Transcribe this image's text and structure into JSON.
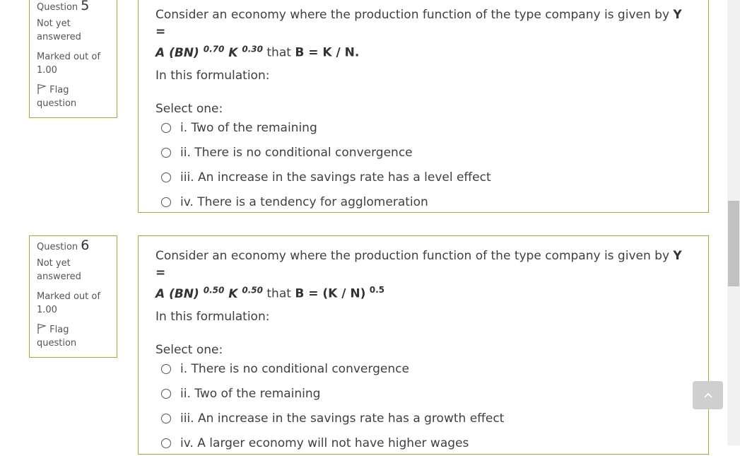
{
  "questions": [
    {
      "label": "Question",
      "number": "5",
      "state_line1": "Not yet",
      "state_line2": "answered",
      "grade_line1": "Marked out of",
      "grade_line2": "1.00",
      "flag_line1": "Flag",
      "flag_line2": "question",
      "text_line1": "Consider an economy where the production function of the type company is given by ",
      "text_y": "Y =",
      "text_a": "A (BN)",
      "exp1": "0.70",
      "text_k": "K",
      "exp2": "0.30",
      "text_that": " that ",
      "text_b": "B = K / N.",
      "exp3": "",
      "sub": "In this formulation:",
      "prompt": "Select one:",
      "options": [
        "i. Two of the remaining",
        "ii. There is no conditional convergence",
        "iii. An increase in the savings rate has a level effect",
        "iv. There is a tendency for agglomeration"
      ]
    },
    {
      "label": "Question",
      "number": "6",
      "state_line1": "Not yet",
      "state_line2": "answered",
      "grade_line1": "Marked out of",
      "grade_line2": "1.00",
      "flag_line1": "Flag",
      "flag_line2": "question",
      "text_line1": "Consider an economy where the production function of the type company is given by ",
      "text_y": "Y =",
      "text_a": "A (BN)",
      "exp1": "0.50",
      "text_k": "K",
      "exp2": "0.50",
      "text_that": " that ",
      "text_b": "B = (K / N)",
      "exp3": "0.5",
      "sub": "In this formulation:",
      "prompt": "Select one:",
      "options": [
        "i. There is no conditional convergence",
        "ii. Two of the remaining",
        "iii. An increase in the savings rate has a growth effect",
        "iv. A larger economy will not have higher wages"
      ]
    }
  ],
  "icons": {
    "flag": "flag-icon",
    "back_to_top": "chevron-up-icon"
  },
  "colors": {
    "border": "#8db33a",
    "text": "#404040"
  }
}
